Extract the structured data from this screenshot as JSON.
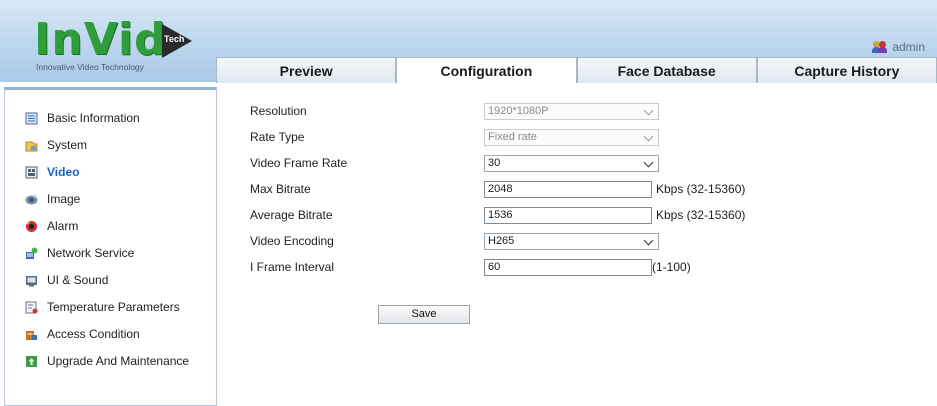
{
  "brand": {
    "name": "InVid",
    "tech": "Tech",
    "tagline": "Innovative Video Technology"
  },
  "user": {
    "name": "admin",
    "icon": "users-icon"
  },
  "tabs": [
    {
      "label": "Preview"
    },
    {
      "label": "Configuration",
      "active": true
    },
    {
      "label": "Face Database"
    },
    {
      "label": "Capture History"
    }
  ],
  "sidebar": {
    "items": [
      {
        "label": "Basic Information",
        "icon": "info-sheet-icon"
      },
      {
        "label": "System",
        "icon": "system-icon"
      },
      {
        "label": "Video",
        "icon": "video-icon",
        "active": true
      },
      {
        "label": "Image",
        "icon": "image-icon"
      },
      {
        "label": "Alarm",
        "icon": "alarm-icon"
      },
      {
        "label": "Network Service",
        "icon": "network-icon"
      },
      {
        "label": "UI & Sound",
        "icon": "ui-sound-icon"
      },
      {
        "label": "Temperature Parameters",
        "icon": "temperature-icon"
      },
      {
        "label": "Access Condition",
        "icon": "access-icon"
      },
      {
        "label": "Upgrade And Maintenance",
        "icon": "upgrade-icon"
      }
    ]
  },
  "form": {
    "resolution": {
      "label": "Resolution",
      "value": "1920*1080P"
    },
    "rate_type": {
      "label": "Rate Type",
      "value": "Fixed rate"
    },
    "frame_rate": {
      "label": "Video Frame Rate",
      "value": "30"
    },
    "max_bitrate": {
      "label": "Max Bitrate",
      "value": "2048",
      "hint": "Kbps (32-15360)"
    },
    "avg_bitrate": {
      "label": "Average Bitrate",
      "value": "1536",
      "hint": "Kbps (32-15360)"
    },
    "encoding": {
      "label": "Video Encoding",
      "value": "H265"
    },
    "iframe": {
      "label": "I Frame Interval",
      "value": "60",
      "hint": "(1-100)"
    },
    "save_label": "Save"
  },
  "colors": {
    "accent": "#1a63c6",
    "header_top": "#d9e8f5",
    "header_bottom": "#a9c9e8",
    "logo_green": "#2f9e3a"
  }
}
